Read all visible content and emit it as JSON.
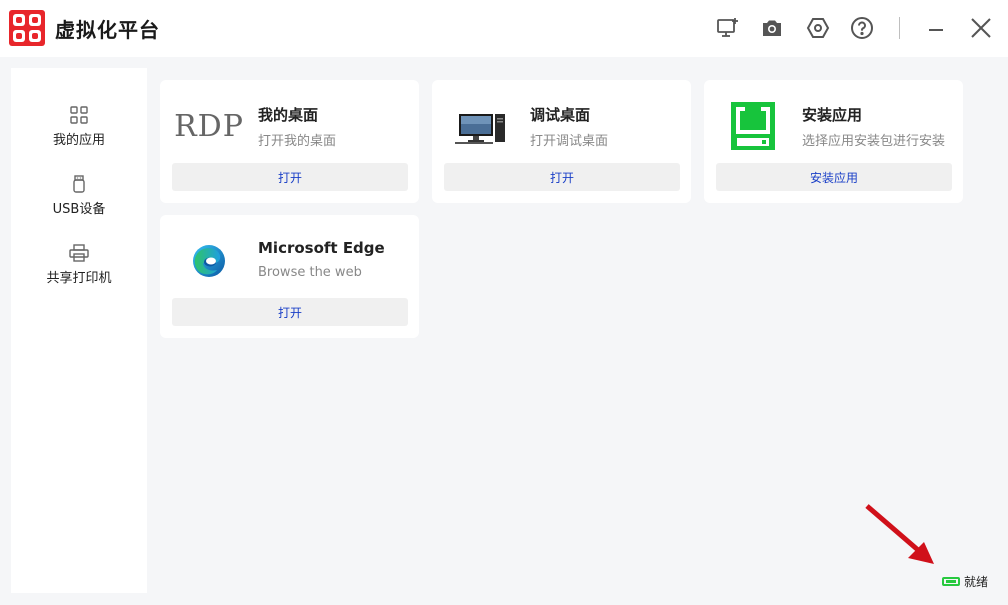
{
  "app": {
    "title": "虚拟化平台"
  },
  "sidebar": {
    "items": [
      {
        "label": "我的应用",
        "icon": "grid-icon"
      },
      {
        "label": "USB设备",
        "icon": "usb-icon"
      },
      {
        "label": "共享打印机",
        "icon": "printer-icon"
      }
    ]
  },
  "apps": [
    {
      "name": "我的桌面",
      "desc": "打开我的桌面",
      "button": "打开",
      "icon_text": "RDP",
      "icon": "rdp-icon"
    },
    {
      "name": "调试桌面",
      "desc": "打开调试桌面",
      "button": "打开",
      "icon": "computer-icon"
    },
    {
      "name": "安装应用",
      "desc": "选择应用安装包进行安装",
      "button": "安装应用",
      "icon": "install-icon"
    },
    {
      "name": "Microsoft Edge",
      "desc": "Browse the web",
      "button": "打开",
      "icon": "edge-icon"
    }
  ],
  "status": {
    "text": "就绪",
    "color": "#27c93f"
  },
  "colors": {
    "accent_red": "#e8262b",
    "button_text": "#1a3fc7",
    "install_green": "#17c43c",
    "annotation_arrow": "#d0101a"
  }
}
